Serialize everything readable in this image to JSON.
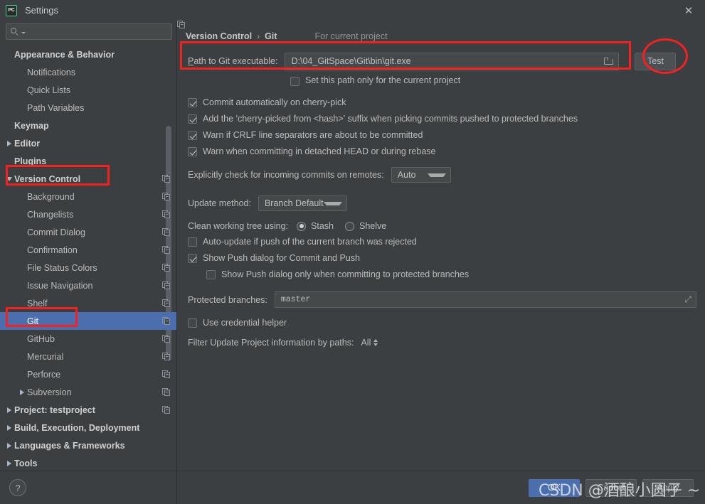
{
  "window": {
    "title": "Settings",
    "logo_text": "PC",
    "close_label": "✕"
  },
  "search": {
    "value": "",
    "placeholder": ""
  },
  "sidebar": {
    "items": [
      {
        "label": "Appearance & Behavior",
        "indent": 0,
        "bold": true,
        "arrow": "none",
        "copy": false,
        "selected": false
      },
      {
        "label": "Notifications",
        "indent": 1,
        "bold": false,
        "arrow": "none",
        "copy": false,
        "selected": false
      },
      {
        "label": "Quick Lists",
        "indent": 1,
        "bold": false,
        "arrow": "none",
        "copy": false,
        "selected": false
      },
      {
        "label": "Path Variables",
        "indent": 1,
        "bold": false,
        "arrow": "none",
        "copy": false,
        "selected": false
      },
      {
        "label": "Keymap",
        "indent": 0,
        "bold": true,
        "arrow": "none",
        "copy": false,
        "selected": false
      },
      {
        "label": "Editor",
        "indent": 0,
        "bold": true,
        "arrow": "collapsed",
        "copy": false,
        "selected": false
      },
      {
        "label": "Plugins",
        "indent": 0,
        "bold": true,
        "arrow": "none",
        "copy": false,
        "selected": false
      },
      {
        "label": "Version Control",
        "indent": 0,
        "bold": true,
        "arrow": "expanded",
        "copy": true,
        "selected": false
      },
      {
        "label": "Background",
        "indent": 1,
        "bold": false,
        "arrow": "none",
        "copy": true,
        "selected": false
      },
      {
        "label": "Changelists",
        "indent": 1,
        "bold": false,
        "arrow": "none",
        "copy": true,
        "selected": false
      },
      {
        "label": "Commit Dialog",
        "indent": 1,
        "bold": false,
        "arrow": "none",
        "copy": true,
        "selected": false
      },
      {
        "label": "Confirmation",
        "indent": 1,
        "bold": false,
        "arrow": "none",
        "copy": true,
        "selected": false
      },
      {
        "label": "File Status Colors",
        "indent": 1,
        "bold": false,
        "arrow": "none",
        "copy": true,
        "selected": false
      },
      {
        "label": "Issue Navigation",
        "indent": 1,
        "bold": false,
        "arrow": "none",
        "copy": true,
        "selected": false
      },
      {
        "label": "Shelf",
        "indent": 1,
        "bold": false,
        "arrow": "none",
        "copy": true,
        "selected": false
      },
      {
        "label": "Git",
        "indent": 1,
        "bold": false,
        "arrow": "none",
        "copy": true,
        "selected": true
      },
      {
        "label": "GitHub",
        "indent": 1,
        "bold": false,
        "arrow": "none",
        "copy": true,
        "selected": false
      },
      {
        "label": "Mercurial",
        "indent": 1,
        "bold": false,
        "arrow": "none",
        "copy": true,
        "selected": false
      },
      {
        "label": "Perforce",
        "indent": 1,
        "bold": false,
        "arrow": "none",
        "copy": true,
        "selected": false
      },
      {
        "label": "Subversion",
        "indent": 1,
        "bold": false,
        "arrow": "collapsed",
        "copy": true,
        "selected": false
      },
      {
        "label": "Project: testproject",
        "indent": 0,
        "bold": true,
        "arrow": "collapsed",
        "copy": true,
        "selected": false
      },
      {
        "label": "Build, Execution, Deployment",
        "indent": 0,
        "bold": true,
        "arrow": "collapsed",
        "copy": false,
        "selected": false
      },
      {
        "label": "Languages & Frameworks",
        "indent": 0,
        "bold": true,
        "arrow": "collapsed",
        "copy": false,
        "selected": false
      },
      {
        "label": "Tools",
        "indent": 0,
        "bold": true,
        "arrow": "collapsed",
        "copy": false,
        "selected": false
      }
    ],
    "help_label": "?"
  },
  "main": {
    "breadcrumb": {
      "parent": "Version Control",
      "separator": "›",
      "current": "Git",
      "scope_note": "For current project"
    },
    "path": {
      "label_prefix": "P",
      "label_rest": "ath to Git executable:",
      "value": "D:\\04_GitSpace\\Git\\bin\\git.exe",
      "test_button": "Test"
    },
    "set_path_only": {
      "label": "Set this path only for the current project",
      "checked": false
    },
    "options": [
      {
        "label": "Commit automatically on cherry-pick",
        "checked": true
      },
      {
        "label": "Add the 'cherry-picked from <hash>' suffix when picking commits pushed to protected branches",
        "checked": true
      },
      {
        "label": "Warn if CRLF line separators are about to be committed",
        "checked": true
      },
      {
        "label": "Warn when committing in detached HEAD or during rebase",
        "checked": true
      }
    ],
    "incoming": {
      "label": "Explicitly check for incoming commits on remotes:",
      "value": "Auto"
    },
    "update_method": {
      "label": "Update method:",
      "value": "Branch Default"
    },
    "clean_tree": {
      "label": "Clean working tree using:",
      "options": [
        {
          "label": "Stash",
          "selected": true
        },
        {
          "label": "Shelve",
          "selected": false
        }
      ]
    },
    "options2": [
      {
        "label": "Auto-update if push of the current branch was rejected",
        "checked": false,
        "indent": 0
      },
      {
        "label": "Show Push dialog for Commit and Push",
        "checked": true,
        "indent": 0
      },
      {
        "label": "Show Push dialog only when committing to protected branches",
        "checked": false,
        "indent": 1
      }
    ],
    "protected_branches": {
      "label": "Protected branches:",
      "value": "master",
      "expand_icon": "⤢"
    },
    "credential_helper": {
      "label": "Use credential helper",
      "checked": false
    },
    "filter_paths": {
      "label": "Filter Update Project information by paths:",
      "value": "All"
    }
  },
  "footer": {
    "ok": "OK",
    "cancel": "Cancel",
    "apply": "Apply"
  },
  "watermark": "CSDN @酒酿小圆子 ~",
  "colors": {
    "accent_selected": "#4b6eaf",
    "annotation_red": "#f42121",
    "window_bg": "#3c3f41",
    "field_bg": "#45494a"
  }
}
